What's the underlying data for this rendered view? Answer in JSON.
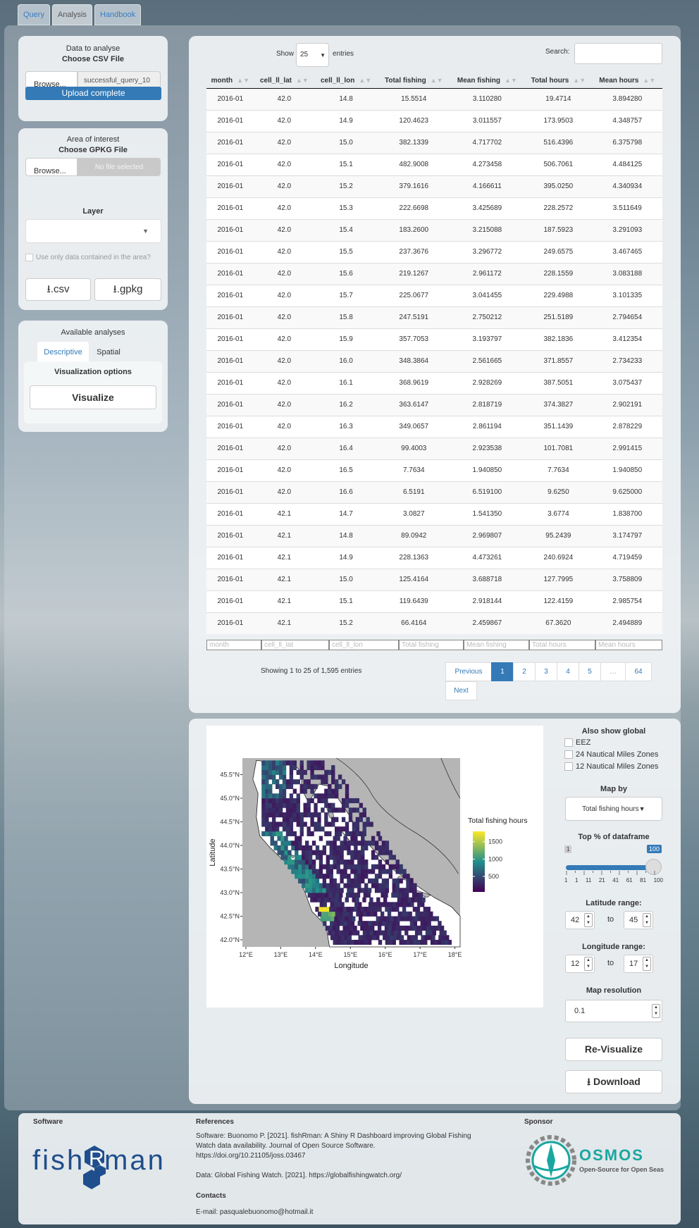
{
  "tabs": [
    "Query",
    "Analysis",
    "Handbook"
  ],
  "left": {
    "data_title": "Data to analyse",
    "csv_label": "Choose CSV File",
    "browse": "Browse...",
    "csv_file": "successful_query_10",
    "upload_status": "Upload complete",
    "area_title": "Area of interest",
    "gpkg_label": "Choose GPKG File",
    "gpkg_file": "No file selected",
    "layer_label": "Layer",
    "use_only": "Use only data contained in the area?",
    "csv_btn": ".csv",
    "gpkg_btn": ".gpkg",
    "available": "Available analyses",
    "tab_descriptive": "Descriptive",
    "tab_spatial": "Spatial",
    "vis_options": "Visualization options",
    "visualize": "Visualize"
  },
  "table": {
    "show": "Show",
    "entries_value": "25",
    "entries": "entries",
    "search": "Search:",
    "columns": [
      "month",
      "cell_ll_lat",
      "cell_ll_lon",
      "Total fishing",
      "Mean fishing",
      "Total hours",
      "Mean hours"
    ],
    "rows": [
      [
        "2016-01",
        "42.0",
        "14.8",
        "15.5514",
        "3.110280",
        "19.4714",
        "3.894280"
      ],
      [
        "2016-01",
        "42.0",
        "14.9",
        "120.4623",
        "3.011557",
        "173.9503",
        "4.348757"
      ],
      [
        "2016-01",
        "42.0",
        "15.0",
        "382.1339",
        "4.717702",
        "516.4396",
        "6.375798"
      ],
      [
        "2016-01",
        "42.0",
        "15.1",
        "482.9008",
        "4.273458",
        "506.7061",
        "4.484125"
      ],
      [
        "2016-01",
        "42.0",
        "15.2",
        "379.1616",
        "4.166611",
        "395.0250",
        "4.340934"
      ],
      [
        "2016-01",
        "42.0",
        "15.3",
        "222.6698",
        "3.425689",
        "228.2572",
        "3.511649"
      ],
      [
        "2016-01",
        "42.0",
        "15.4",
        "183.2600",
        "3.215088",
        "187.5923",
        "3.291093"
      ],
      [
        "2016-01",
        "42.0",
        "15.5",
        "237.3676",
        "3.296772",
        "249.6575",
        "3.467465"
      ],
      [
        "2016-01",
        "42.0",
        "15.6",
        "219.1267",
        "2.961172",
        "228.1559",
        "3.083188"
      ],
      [
        "2016-01",
        "42.0",
        "15.7",
        "225.0677",
        "3.041455",
        "229.4988",
        "3.101335"
      ],
      [
        "2016-01",
        "42.0",
        "15.8",
        "247.5191",
        "2.750212",
        "251.5189",
        "2.794654"
      ],
      [
        "2016-01",
        "42.0",
        "15.9",
        "357.7053",
        "3.193797",
        "382.1836",
        "3.412354"
      ],
      [
        "2016-01",
        "42.0",
        "16.0",
        "348.3864",
        "2.561665",
        "371.8557",
        "2.734233"
      ],
      [
        "2016-01",
        "42.0",
        "16.1",
        "368.9619",
        "2.928269",
        "387.5051",
        "3.075437"
      ],
      [
        "2016-01",
        "42.0",
        "16.2",
        "363.6147",
        "2.818719",
        "374.3827",
        "2.902191"
      ],
      [
        "2016-01",
        "42.0",
        "16.3",
        "349.0657",
        "2.861194",
        "351.1439",
        "2.878229"
      ],
      [
        "2016-01",
        "42.0",
        "16.4",
        "99.4003",
        "2.923538",
        "101.7081",
        "2.991415"
      ],
      [
        "2016-01",
        "42.0",
        "16.5",
        "7.7634",
        "1.940850",
        "7.7634",
        "1.940850"
      ],
      [
        "2016-01",
        "42.0",
        "16.6",
        "6.5191",
        "6.519100",
        "9.6250",
        "9.625000"
      ],
      [
        "2016-01",
        "42.1",
        "14.7",
        "3.0827",
        "1.541350",
        "3.6774",
        "1.838700"
      ],
      [
        "2016-01",
        "42.1",
        "14.8",
        "89.0942",
        "2.969807",
        "95.2439",
        "3.174797"
      ],
      [
        "2016-01",
        "42.1",
        "14.9",
        "228.1363",
        "4.473261",
        "240.6924",
        "4.719459"
      ],
      [
        "2016-01",
        "42.1",
        "15.0",
        "125.4164",
        "3.688718",
        "127.7995",
        "3.758809"
      ],
      [
        "2016-01",
        "42.1",
        "15.1",
        "119.6439",
        "2.918144",
        "122.4159",
        "2.985754"
      ],
      [
        "2016-01",
        "42.1",
        "15.2",
        "66.4164",
        "2.459867",
        "67.3620",
        "2.494889"
      ]
    ],
    "info": "Showing 1 to 25 of 1,595 entries",
    "pages": [
      "Previous",
      "1",
      "2",
      "3",
      "4",
      "5",
      "…",
      "64",
      "Next"
    ]
  },
  "map": {
    "legend_title": "Total fishing hours",
    "legend_ticks": [
      "1500",
      "1000",
      "500"
    ],
    "xlabel": "Longitude",
    "ylabel": "Latitude",
    "xticks": [
      "12°E",
      "13°E",
      "14°E",
      "15°E",
      "16°E",
      "17°E",
      "18°E"
    ],
    "yticks": [
      "45.5°N",
      "45.0°N",
      "44.5°N",
      "44.0°N",
      "43.5°N",
      "43.0°N",
      "42.5°N",
      "42.0°N"
    ],
    "colors": {
      "land": "#b5b5b5",
      "sea": "#ffffff",
      "low": "#440154",
      "mid": "#21908c",
      "high": "#fde725"
    }
  },
  "controls": {
    "also_show": "Also show global",
    "eez": "EEZ",
    "nm24": "24 Nautical Miles Zones",
    "nm12": "12 Nautical Miles Zones",
    "map_by": "Map by",
    "map_by_value": "Total fishing hours",
    "top_pct": "Top % of dataframe",
    "slider_min": "1",
    "slider_max": "100",
    "slider_value": 100,
    "slider_ticks": [
      "1",
      "1",
      "11",
      "21",
      "41",
      "61",
      "81",
      "100"
    ],
    "lat_range": "Latitude range:",
    "lat_from": "42",
    "lat_to": "45",
    "lon_range": "Longitude range:",
    "lon_from": "12",
    "lon_to": "17",
    "to": "to",
    "resolution": "Map resolution",
    "resolution_value": "0.1",
    "revisualize": "Re-Visualize",
    "download": "Download"
  },
  "footer": {
    "software": "Software",
    "logo_text": "fishRman",
    "references": "References",
    "ref1": "Software: Buonomo P. [2021]. fishRman: A Shiny R Dashboard improving Global Fishing Watch data availability. Journal of Open Source Software. https://doi.org/10.21105/joss.03467",
    "ref2": "Data: Global Fishing Watch. [2021]. https://globalfishingwatch.org/",
    "contacts": "Contacts",
    "email": "E-mail: pasqualebuonomo@hotmail.it",
    "sponsor": "Sponsor",
    "osmos": "OSMOS",
    "osmos_sub": "Open-Source for Open Seas"
  }
}
